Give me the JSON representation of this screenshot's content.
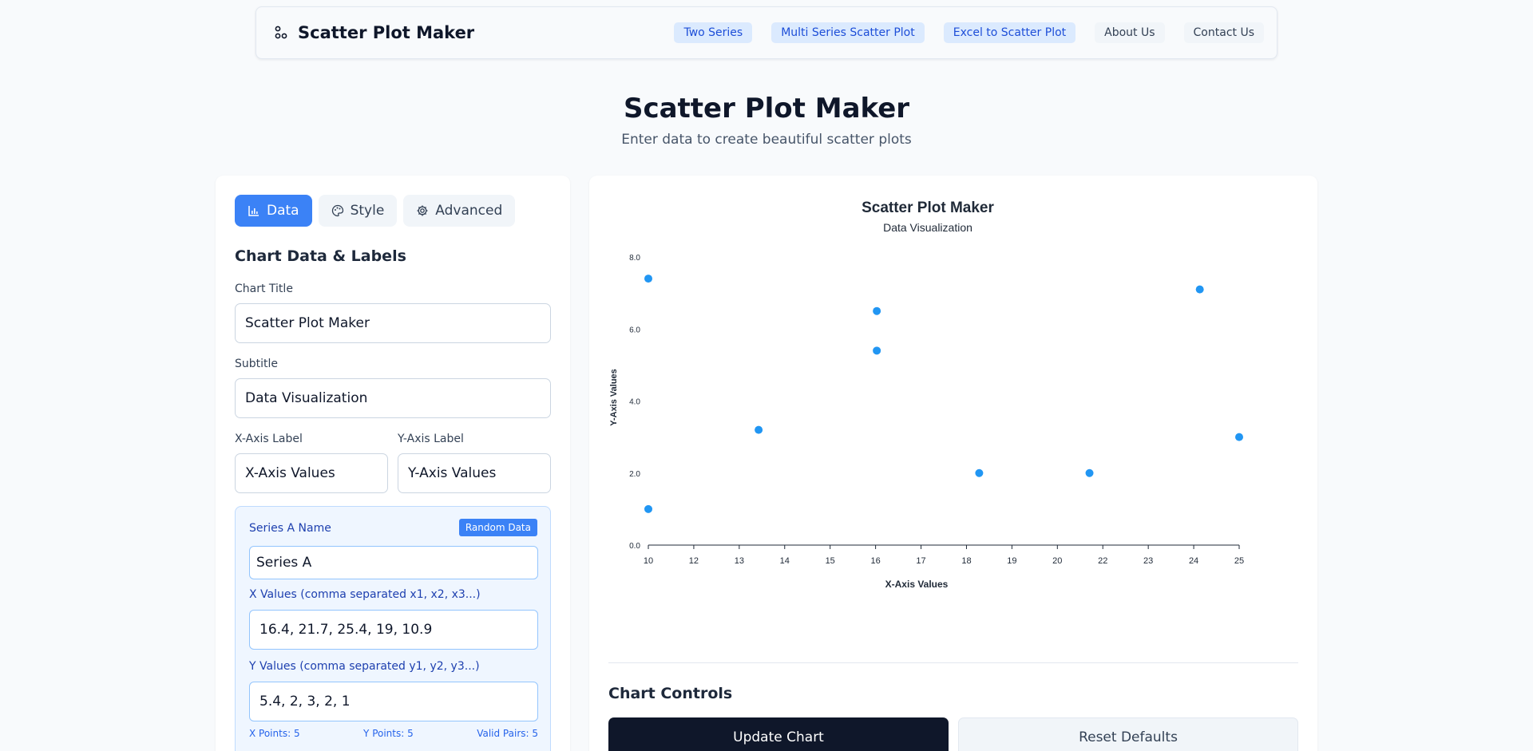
{
  "nav": {
    "brand": "Scatter Plot Maker",
    "links": [
      {
        "label": "Two Series",
        "style": "primary"
      },
      {
        "label": "Multi Series Scatter Plot",
        "style": "primary"
      },
      {
        "label": "Excel to Scatter Plot",
        "style": "primary"
      },
      {
        "label": "About Us",
        "style": "plain"
      },
      {
        "label": "Contact Us",
        "style": "plain"
      }
    ]
  },
  "hero": {
    "title": "Scatter Plot Maker",
    "subtitle": "Enter data to create beautiful scatter plots"
  },
  "tabs": {
    "data": "Data",
    "style": "Style",
    "advanced": "Advanced",
    "active": "Data"
  },
  "form": {
    "section_title": "Chart Data & Labels",
    "chart_title_label": "Chart Title",
    "chart_title_value": "Scatter Plot Maker",
    "subtitle_label": "Subtitle",
    "subtitle_value": "Data Visualization",
    "x_axis_label": "X-Axis Label",
    "x_axis_value": "X-Axis Values",
    "y_axis_label": "Y-Axis Label",
    "y_axis_value": "Y-Axis Values"
  },
  "series_a": {
    "name_label": "Series A Name",
    "random_button": "Random Data",
    "name_value": "Series A",
    "x_label": "X Values (comma separated x1, x2, x3...)",
    "x_value": "16.4, 21.7, 25.4, 19, 10.9",
    "y_label": "Y Values (comma separated y1, y2, y3...)",
    "y_value": "5.4, 2, 3, 2, 1",
    "x_points": "X Points: 5",
    "y_points": "Y Points: 5",
    "valid_pairs": "Valid Pairs: 5"
  },
  "controls": {
    "title": "Chart Controls",
    "update": "Update Chart",
    "reset": "Reset Defaults"
  },
  "colors": {
    "accent": "#3b82f6",
    "point": "#2196f3"
  },
  "chart_data": {
    "type": "scatter",
    "title": "Scatter Plot Maker",
    "subtitle": "Data Visualization",
    "xlabel": "X-Axis Values",
    "ylabel": "Y-Axis Values",
    "x_ticks": [
      "10",
      "12",
      "13",
      "14",
      "15",
      "16",
      "17",
      "18",
      "19",
      "20",
      "22",
      "23",
      "24",
      "25"
    ],
    "y_ticks": [
      "0.0",
      "2.0",
      "4.0",
      "6.0",
      "8.0"
    ],
    "xlim": [
      10,
      25
    ],
    "ylim": [
      0,
      8
    ],
    "grid": false,
    "series": [
      {
        "points": [
          {
            "x": 10.0,
            "y": 7.4
          },
          {
            "x": 10.0,
            "y": 1.0
          },
          {
            "x": 12.8,
            "y": 3.2
          },
          {
            "x": 15.8,
            "y": 6.5
          },
          {
            "x": 15.8,
            "y": 5.4
          },
          {
            "x": 18.4,
            "y": 2.0
          },
          {
            "x": 21.2,
            "y": 2.0
          },
          {
            "x": 24.0,
            "y": 7.1
          },
          {
            "x": 25.0,
            "y": 3.0
          }
        ]
      }
    ]
  }
}
